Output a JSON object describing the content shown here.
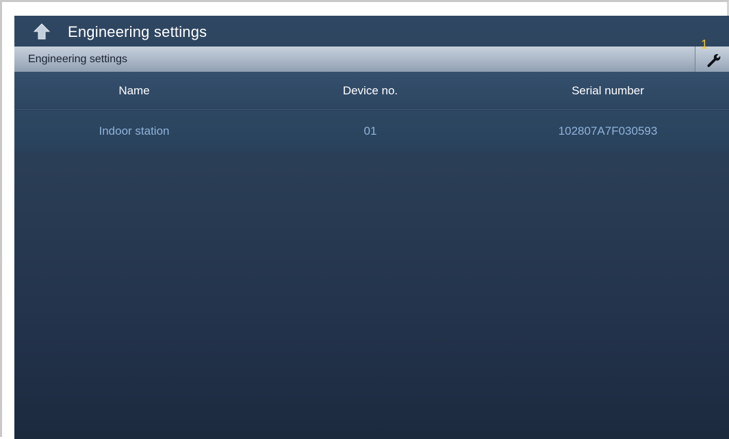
{
  "header": {
    "title": "Engineering settings",
    "back_icon": "back-arrow-icon"
  },
  "section": {
    "label": "Engineering settings",
    "tool_icon": "wrench-icon",
    "badge": "1"
  },
  "table": {
    "columns": [
      "Name",
      "Device no.",
      "Serial number"
    ],
    "rows": [
      {
        "name": "Indoor station",
        "device_no": "01",
        "serial": "102807A7F030593"
      }
    ]
  },
  "colors": {
    "background": "#2a3e56",
    "section_bar": "#aab7c6",
    "row_text": "#8fb3dc",
    "badge": "#f2c232"
  }
}
